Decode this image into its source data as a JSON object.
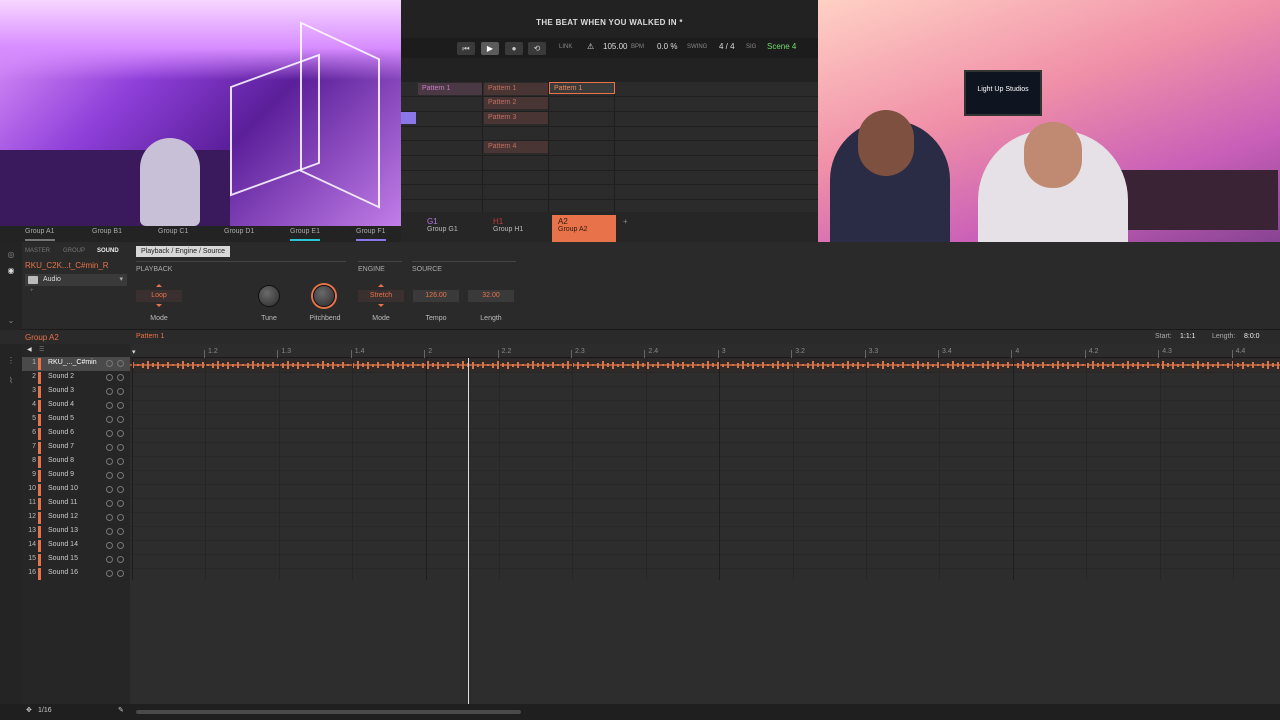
{
  "song": {
    "title": "THE BEAT WHEN YOU WALKED IN *"
  },
  "transport": {
    "link": "LINK",
    "bpm": "105.00",
    "bpm_unit": "BPM",
    "swing": "0.0 %",
    "swing_label": "SWING",
    "sig": "4 / 4",
    "sig_label": "SIG",
    "scene": "Scene 4"
  },
  "arranger": {
    "patterns": [
      {
        "label": "Pattern 1"
      },
      {
        "label": "Pattern 1"
      },
      {
        "label": "Pattern 2"
      },
      {
        "label": "Pattern 3"
      },
      {
        "label": "Pattern 4"
      },
      {
        "label": "Pattern 1"
      }
    ]
  },
  "groups_left": [
    "Group A1",
    "Group B1",
    "Group C1",
    "Group D1",
    "Group E1",
    "Group F1"
  ],
  "groups_right": [
    {
      "code": "G1",
      "name": "Group G1"
    },
    {
      "code": "H1",
      "name": "Group H1"
    },
    {
      "code": "A2",
      "name": "Group A2"
    },
    {
      "code": "+",
      "name": ""
    }
  ],
  "sound_panel": {
    "tabs": [
      "MASTER",
      "GROUP",
      "SOUND"
    ],
    "sound_name": "RKU_C2K...t_C#min_R",
    "plugin": "Audio",
    "page_tab": "Playback / Engine / Source",
    "sections": {
      "playback": "PLAYBACK",
      "engine": "ENGINE",
      "source": "SOURCE"
    },
    "params": {
      "mode_value": "Loop",
      "mode_label": "Mode",
      "tune_label": "Tune",
      "pitchbend_label": "Pitchbend",
      "engine_mode_value": "Stretch",
      "engine_mode_label": "Mode",
      "tempo_value": "126.00",
      "tempo_label": "Tempo",
      "length_value": "32.00",
      "length_label": "Length"
    }
  },
  "editor": {
    "group": "Group A2",
    "pattern": "Pattern 1",
    "start_label": "Start:",
    "start_value": "1:1:1",
    "length_label": "Length:",
    "length_value": "8:0:0",
    "ruler": [
      "1.2",
      "1.3",
      "1.4",
      "2",
      "2.2",
      "2.3",
      "2.4",
      "3",
      "3.2",
      "3.3",
      "3.4",
      "4",
      "4.2",
      "4.3",
      "4.4"
    ],
    "sounds": [
      {
        "num": "1",
        "name": "RKU_..._C#min"
      },
      {
        "num": "2",
        "name": "Sound 2"
      },
      {
        "num": "3",
        "name": "Sound 3"
      },
      {
        "num": "4",
        "name": "Sound 4"
      },
      {
        "num": "5",
        "name": "Sound 5"
      },
      {
        "num": "6",
        "name": "Sound 6"
      },
      {
        "num": "7",
        "name": "Sound 7"
      },
      {
        "num": "8",
        "name": "Sound 8"
      },
      {
        "num": "9",
        "name": "Sound 9"
      },
      {
        "num": "10",
        "name": "Sound 10"
      },
      {
        "num": "11",
        "name": "Sound 11"
      },
      {
        "num": "12",
        "name": "Sound 12"
      },
      {
        "num": "13",
        "name": "Sound 13"
      },
      {
        "num": "14",
        "name": "Sound 14"
      },
      {
        "num": "15",
        "name": "Sound 15"
      },
      {
        "num": "16",
        "name": "Sound 16"
      }
    ],
    "step_resolution": "1/16"
  },
  "stream_overlay": {
    "tv_text": "Light Up Studios"
  },
  "colors": {
    "accent": "#e8734a",
    "scene": "#6fdc6f"
  }
}
